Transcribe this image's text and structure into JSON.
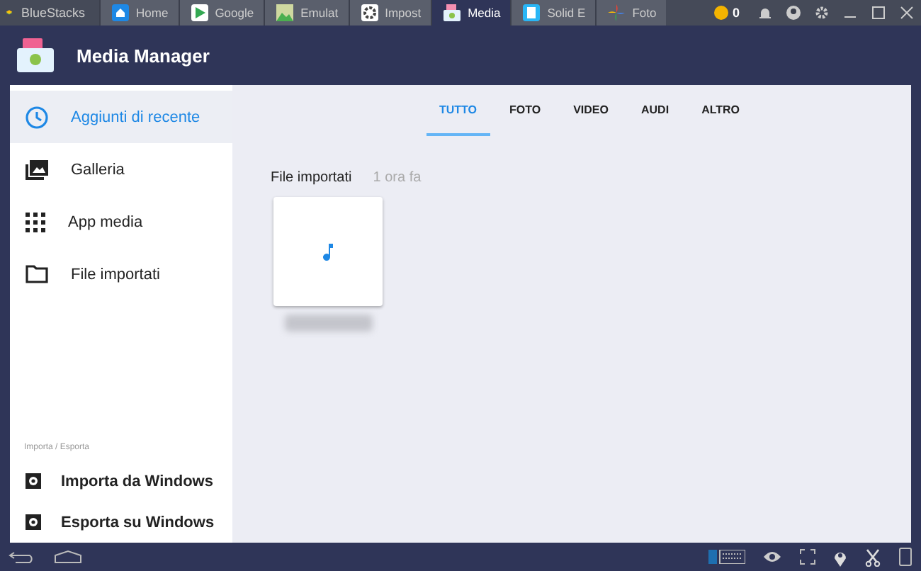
{
  "emulator": {
    "brand": "BlueStacks",
    "tabs": [
      {
        "label": "Home",
        "selected": false
      },
      {
        "label": "Google",
        "selected": false
      },
      {
        "label": "Emulat",
        "selected": false
      },
      {
        "label": "Impost",
        "selected": false
      },
      {
        "label": "Media",
        "selected": true
      },
      {
        "label": "Solid E",
        "selected": false
      },
      {
        "label": "Foto",
        "selected": false
      }
    ],
    "coins": "0"
  },
  "app": {
    "title": "Media Manager"
  },
  "sidebar": {
    "items": [
      {
        "label": "Aggiunti di recente",
        "selected": true
      },
      {
        "label": "Galleria",
        "selected": false
      },
      {
        "label": "App media",
        "selected": false
      },
      {
        "label": "File importati",
        "selected": false
      }
    ],
    "section_title": "Importa / Esporta",
    "actions": [
      {
        "label": "Importa da Windows"
      },
      {
        "label": "Esporta su Windows"
      }
    ]
  },
  "filters": [
    {
      "label": "TUTTO",
      "selected": true
    },
    {
      "label": "FOTO",
      "selected": false
    },
    {
      "label": "VIDEO",
      "selected": false
    },
    {
      "label": "AUDI",
      "selected": false
    },
    {
      "label": "ALTRO",
      "selected": false
    }
  ],
  "group": {
    "title": "File importati",
    "time": "1 ora fa",
    "files": [
      {
        "kind": "audio"
      }
    ]
  }
}
